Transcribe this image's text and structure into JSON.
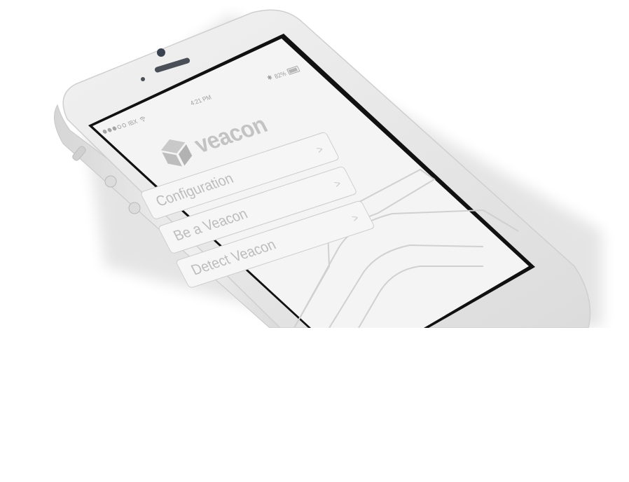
{
  "status": {
    "carrier": "IBX",
    "time": "4:21 PM",
    "battery": "82%"
  },
  "app": {
    "name": "veacon"
  },
  "menu": [
    {
      "label": "Configuration",
      "chevron": ">"
    },
    {
      "label": "Be a Veacon",
      "chevron": ">"
    },
    {
      "label": "Detect Veacon",
      "chevron": ">"
    }
  ],
  "icons": [
    "cube-logo-icon",
    "wifi-icon",
    "bluetooth-icon",
    "battery-icon",
    "chevron-right-icon"
  ],
  "colors": {
    "screen_bg": "#f4f4f4",
    "phone_body": "#e9e9e9",
    "text": "#bcbcbc"
  }
}
